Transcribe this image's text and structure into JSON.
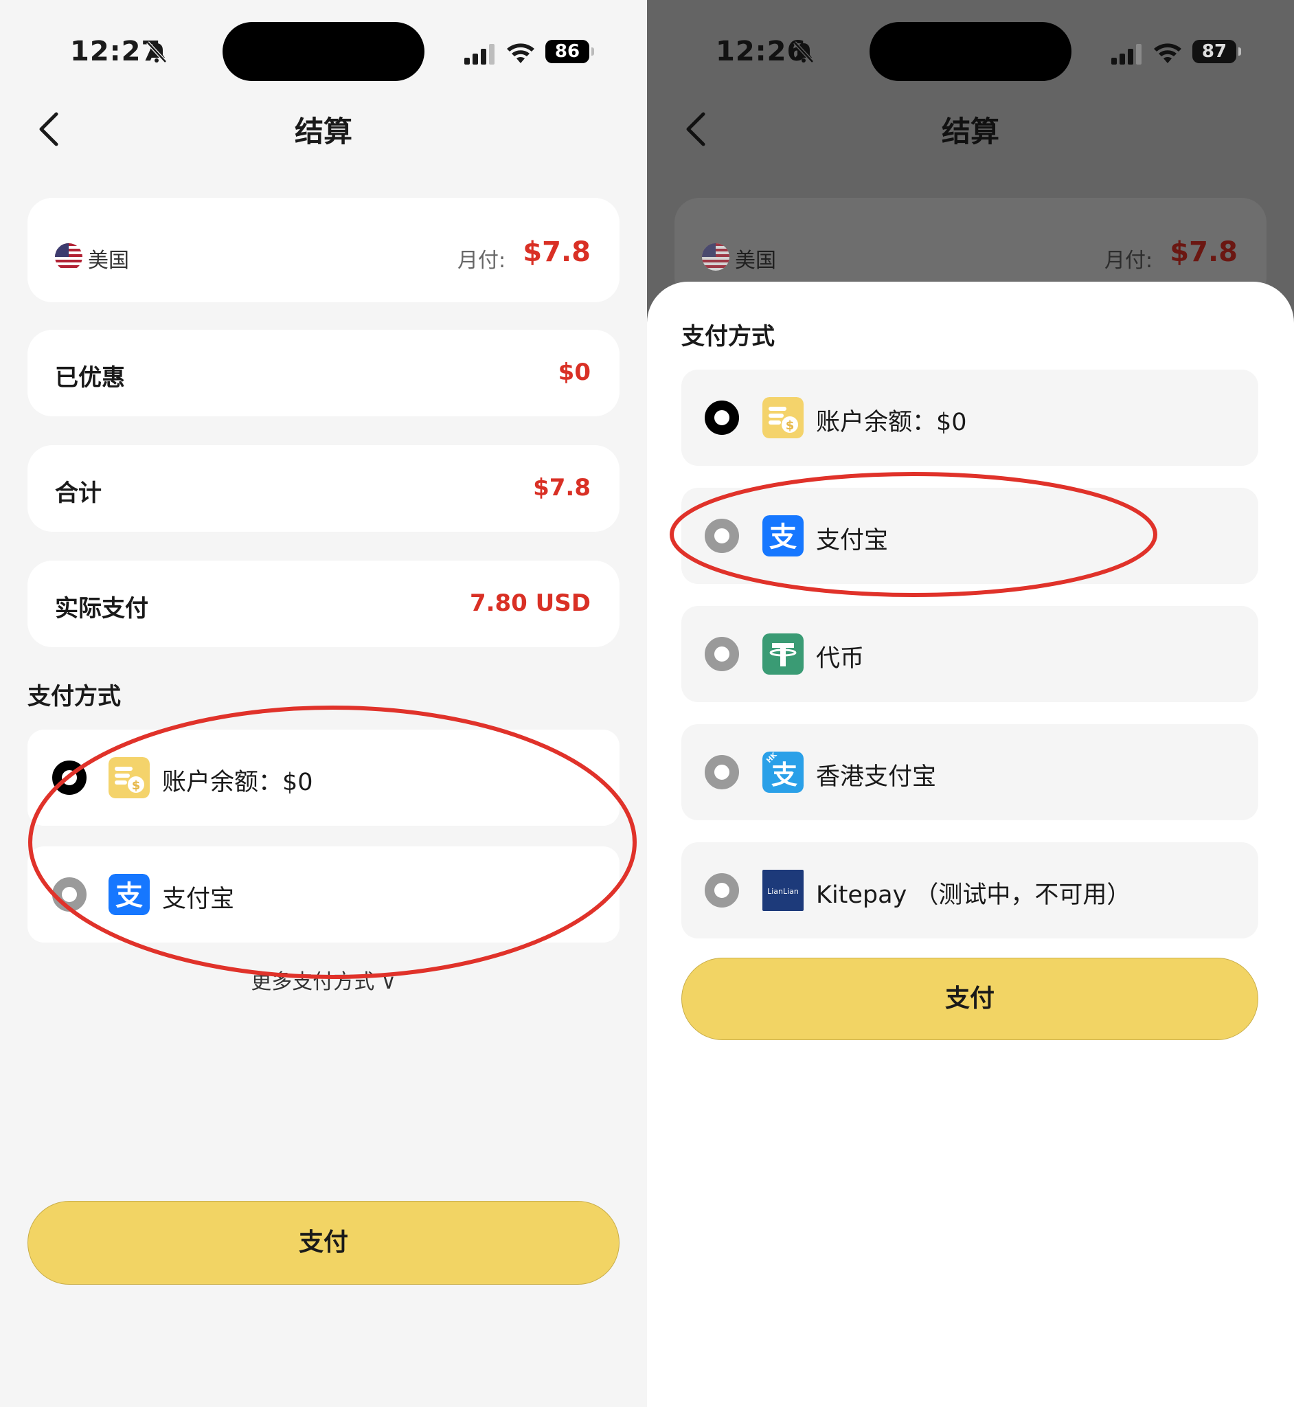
{
  "left": {
    "status": {
      "time": "12:27",
      "battery": "86"
    },
    "header": {
      "title": "结算"
    },
    "country": {
      "name": "美国",
      "monthly_label": "月付:",
      "monthly_value": "$7.8"
    },
    "discount": {
      "label": "已优惠",
      "value": "$0"
    },
    "total": {
      "label": "合计",
      "value": "$7.8"
    },
    "actual": {
      "label": "实际支付",
      "value": "7.80 USD"
    },
    "payment": {
      "section_title": "支付方式",
      "items": [
        {
          "label": "账户余额：$0",
          "selected": true,
          "icon": "wallet-coin-icon"
        },
        {
          "label": "支付宝",
          "selected": false,
          "icon": "alipay-icon"
        }
      ],
      "more_label": "更多支付方式 ∨"
    },
    "pay_button": "支付"
  },
  "right": {
    "status": {
      "time": "12:26",
      "battery": "87"
    },
    "header": {
      "title": "结算"
    },
    "country": {
      "name": "美国",
      "monthly_label": "月付:",
      "monthly_value": "$7.8"
    },
    "sheet": {
      "section_title": "支付方式",
      "items": [
        {
          "label": "账户余额：$0",
          "selected": true,
          "icon": "wallet-coin-icon"
        },
        {
          "label": "支付宝",
          "selected": false,
          "icon": "alipay-icon"
        },
        {
          "label": "代币",
          "selected": false,
          "icon": "tether-icon"
        },
        {
          "label": "香港支付宝",
          "selected": false,
          "icon": "alipay-hk-icon"
        },
        {
          "label": "Kitepay （测试中，不可用）",
          "selected": false,
          "icon": "lianlian-icon",
          "icon_text": "LianLian"
        }
      ],
      "pay_button": "支付"
    }
  },
  "colors": {
    "accent_red": "#d93025",
    "button_yellow": "#f2d464",
    "annotation_red": "#e0322a"
  }
}
